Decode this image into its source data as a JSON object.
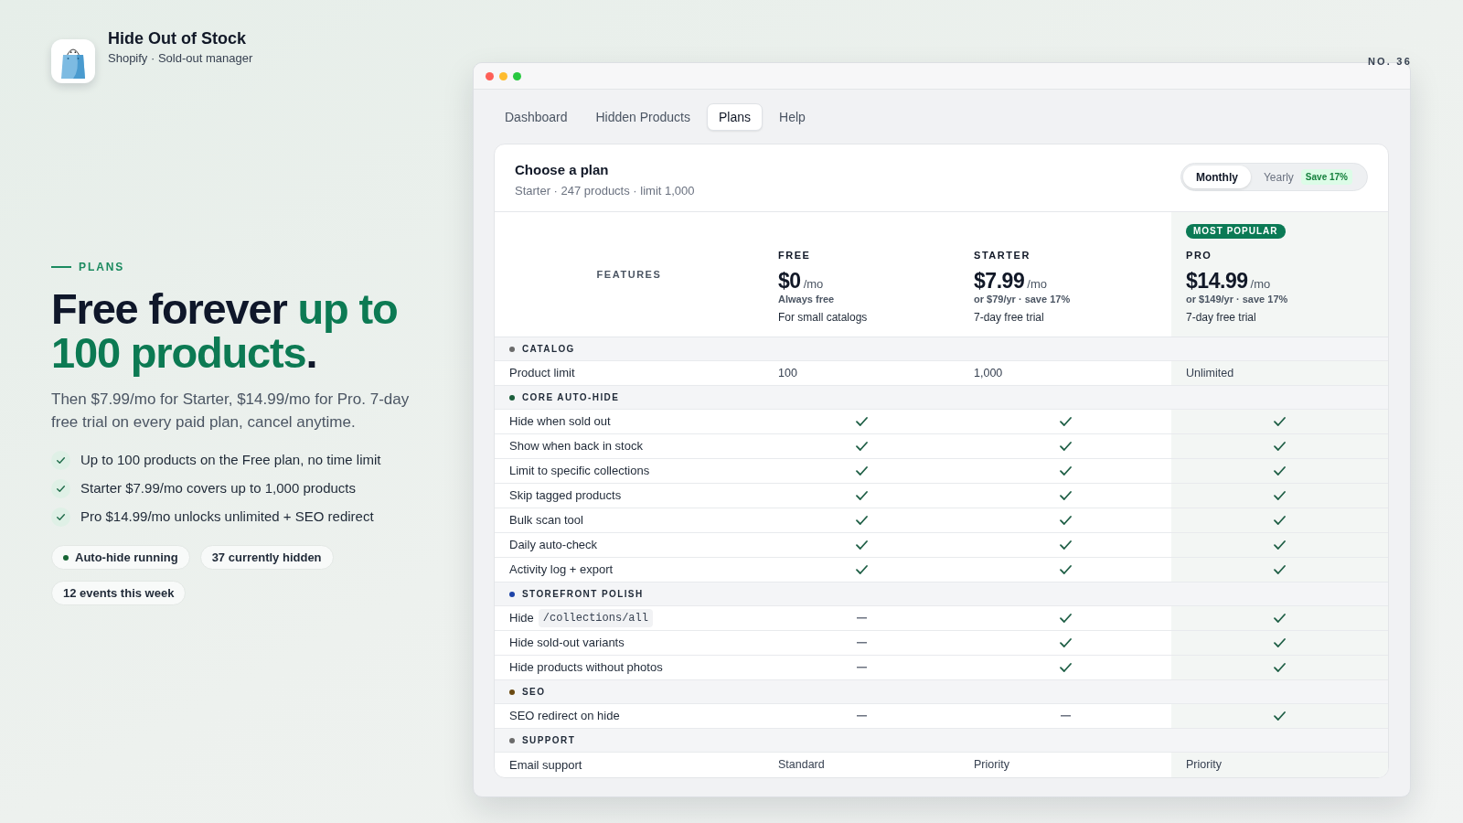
{
  "app": {
    "name": "Hide Out of Stock",
    "subtitle": "Shopify · Sold-out manager"
  },
  "issue_label": "NO. 36",
  "hero": {
    "eyebrow": "PLANS",
    "headline": [
      {
        "text": "Free forever ",
        "accent": false
      },
      {
        "text": "up to 100 products",
        "accent": true
      },
      {
        "text": ".",
        "accent": false
      }
    ],
    "description": "Then $7.99/mo for Starter, $14.99/mo for Pro. 7-day free trial on every paid plan, cancel anytime.",
    "bullets": [
      "Up to 100 products on the Free plan, no time limit",
      "Starter $7.99/mo covers up to 1,000 products",
      "Pro $14.99/mo unlocks unlimited + SEO redirect"
    ],
    "chips": [
      {
        "label": "Auto-hide running",
        "dot": true
      },
      {
        "label": "37 currently hidden",
        "dot": false
      },
      {
        "label": "12 events this week",
        "dot": false
      }
    ]
  },
  "window": {
    "tabs": [
      {
        "label": "Dashboard",
        "selected": false
      },
      {
        "label": "Hidden Products",
        "selected": false
      },
      {
        "label": "Plans",
        "selected": true
      },
      {
        "label": "Help",
        "selected": false
      }
    ],
    "card": {
      "title": "Choose a plan",
      "subtitle": "Starter · 247 products · limit 1,000",
      "billing_toggle": [
        {
          "label": "Monthly",
          "selected": true
        },
        {
          "label": "Yearly",
          "selected": false,
          "badge": "Save 17%"
        }
      ],
      "features_heading": "FEATURES",
      "plans": [
        {
          "name": "FREE",
          "price": "$0",
          "period": "/mo",
          "note": "Always free",
          "tagline": "For small catalogs",
          "highlighted": false
        },
        {
          "name": "STARTER",
          "price": "$7.99",
          "period": "/mo",
          "note": "or $79/yr · save 17%",
          "tagline": "7-day free trial",
          "highlighted": false
        },
        {
          "name": "PRO",
          "badge": "MOST POPULAR",
          "price": "$14.99",
          "period": "/mo",
          "note": "or $149/yr · save 17%",
          "tagline": "7-day free trial",
          "highlighted": true
        }
      ],
      "sections": [
        {
          "title": "CATALOG",
          "color": "#6b6b6b",
          "rows": [
            {
              "feature": "Product limit",
              "cells": [
                {
                  "kind": "text",
                  "text": "100"
                },
                {
                  "kind": "text",
                  "text": "1,000"
                },
                {
                  "kind": "text",
                  "text": "Unlimited"
                }
              ]
            }
          ]
        },
        {
          "title": "CORE AUTO-HIDE",
          "color": "#1b5e3b",
          "rows": [
            {
              "feature": "Hide when sold out",
              "cells": [
                {
                  "kind": "check"
                },
                {
                  "kind": "check"
                },
                {
                  "kind": "check"
                }
              ]
            },
            {
              "feature": "Show when back in stock",
              "cells": [
                {
                  "kind": "check"
                },
                {
                  "kind": "check"
                },
                {
                  "kind": "check"
                }
              ]
            },
            {
              "feature": "Limit to specific collections",
              "cells": [
                {
                  "kind": "check"
                },
                {
                  "kind": "check"
                },
                {
                  "kind": "check"
                }
              ]
            },
            {
              "feature": "Skip tagged products",
              "cells": [
                {
                  "kind": "check"
                },
                {
                  "kind": "check"
                },
                {
                  "kind": "check"
                }
              ]
            },
            {
              "feature": "Bulk scan tool",
              "cells": [
                {
                  "kind": "check"
                },
                {
                  "kind": "check"
                },
                {
                  "kind": "check"
                }
              ]
            },
            {
              "feature": "Daily auto-check",
              "cells": [
                {
                  "kind": "check"
                },
                {
                  "kind": "check"
                },
                {
                  "kind": "check"
                }
              ]
            },
            {
              "feature": "Activity log + export",
              "cells": [
                {
                  "kind": "check"
                },
                {
                  "kind": "check"
                },
                {
                  "kind": "check"
                }
              ]
            }
          ]
        },
        {
          "title": "STOREFRONT POLISH",
          "color": "#1e44a8",
          "rows": [
            {
              "feature": "Hide",
              "code": "/collections/all",
              "cells": [
                {
                  "kind": "dash"
                },
                {
                  "kind": "check"
                },
                {
                  "kind": "check"
                }
              ]
            },
            {
              "feature": "Hide sold-out variants",
              "cells": [
                {
                  "kind": "dash"
                },
                {
                  "kind": "check"
                },
                {
                  "kind": "check"
                }
              ]
            },
            {
              "feature": "Hide products without photos",
              "cells": [
                {
                  "kind": "dash"
                },
                {
                  "kind": "check"
                },
                {
                  "kind": "check"
                }
              ]
            }
          ]
        },
        {
          "title": "SEO",
          "color": "#6b4a12",
          "rows": [
            {
              "feature": "SEO redirect on hide",
              "cells": [
                {
                  "kind": "dash"
                },
                {
                  "kind": "dash"
                },
                {
                  "kind": "check"
                }
              ]
            }
          ]
        },
        {
          "title": "SUPPORT",
          "color": "#6b6b6b",
          "rows": [
            {
              "feature": "Email support",
              "cells": [
                {
                  "kind": "text",
                  "text": "Standard"
                },
                {
                  "kind": "text",
                  "text": "Priority"
                },
                {
                  "kind": "text",
                  "text": "Priority"
                }
              ]
            }
          ]
        }
      ]
    }
  }
}
